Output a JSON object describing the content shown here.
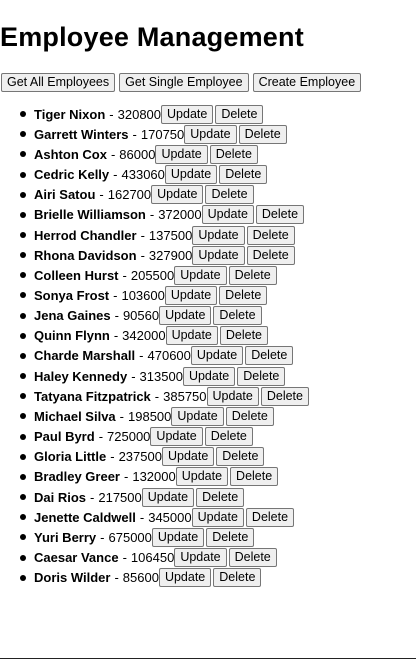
{
  "page": {
    "title": "Employee Management"
  },
  "toolbar": {
    "get_all_label": "Get All Employees",
    "get_single_label": "Get Single Employee",
    "create_label": "Create Employee"
  },
  "row_actions": {
    "update_label": "Update",
    "delete_label": "Delete"
  },
  "separator": "-",
  "employees": [
    {
      "name": "Tiger Nixon",
      "salary": "320800"
    },
    {
      "name": "Garrett Winters",
      "salary": "170750"
    },
    {
      "name": "Ashton Cox",
      "salary": "86000"
    },
    {
      "name": "Cedric Kelly",
      "salary": "433060"
    },
    {
      "name": "Airi Satou",
      "salary": "162700"
    },
    {
      "name": "Brielle Williamson",
      "salary": "372000"
    },
    {
      "name": "Herrod Chandler",
      "salary": "137500"
    },
    {
      "name": "Rhona Davidson",
      "salary": "327900"
    },
    {
      "name": "Colleen Hurst",
      "salary": "205500"
    },
    {
      "name": "Sonya Frost",
      "salary": "103600"
    },
    {
      "name": "Jena Gaines",
      "salary": "90560"
    },
    {
      "name": "Quinn Flynn",
      "salary": "342000"
    },
    {
      "name": "Charde Marshall",
      "salary": "470600"
    },
    {
      "name": "Haley Kennedy",
      "salary": "313500"
    },
    {
      "name": "Tatyana Fitzpatrick",
      "salary": "385750"
    },
    {
      "name": "Michael Silva",
      "salary": "198500"
    },
    {
      "name": "Paul Byrd",
      "salary": "725000"
    },
    {
      "name": "Gloria Little",
      "salary": "237500"
    },
    {
      "name": "Bradley Greer",
      "salary": "132000"
    },
    {
      "name": "Dai Rios",
      "salary": "217500"
    },
    {
      "name": "Jenette Caldwell",
      "salary": "345000"
    },
    {
      "name": "Yuri Berry",
      "salary": "675000"
    },
    {
      "name": "Caesar Vance",
      "salary": "106450"
    },
    {
      "name": "Doris Wilder",
      "salary": "85600"
    }
  ]
}
